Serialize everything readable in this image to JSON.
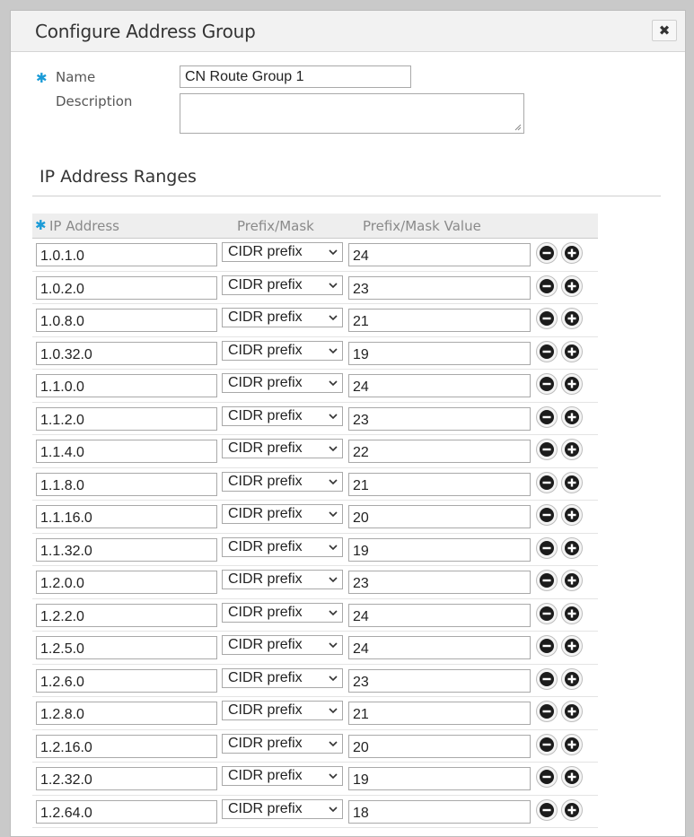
{
  "dialog": {
    "title": "Configure Address Group",
    "close_glyph": "✖"
  },
  "form": {
    "required_mark": "✱",
    "name_label": "Name",
    "name_value": "CN Route Group 1",
    "description_label": "Description",
    "description_value": ""
  },
  "ranges": {
    "section_title": "IP Address Ranges",
    "headers": {
      "required_mark": "✱",
      "ip": "IP Address",
      "prefix": "Prefix/Mask",
      "value": "Prefix/Mask Value"
    },
    "rows": [
      {
        "ip": "1.0.1.0",
        "prefix": "CIDR prefix",
        "value": "24"
      },
      {
        "ip": "1.0.2.0",
        "prefix": "CIDR prefix",
        "value": "23"
      },
      {
        "ip": "1.0.8.0",
        "prefix": "CIDR prefix",
        "value": "21"
      },
      {
        "ip": "1.0.32.0",
        "prefix": "CIDR prefix",
        "value": "19"
      },
      {
        "ip": "1.1.0.0",
        "prefix": "CIDR prefix",
        "value": "24"
      },
      {
        "ip": "1.1.2.0",
        "prefix": "CIDR prefix",
        "value": "23"
      },
      {
        "ip": "1.1.4.0",
        "prefix": "CIDR prefix",
        "value": "22"
      },
      {
        "ip": "1.1.8.0",
        "prefix": "CIDR prefix",
        "value": "21"
      },
      {
        "ip": "1.1.16.0",
        "prefix": "CIDR prefix",
        "value": "20"
      },
      {
        "ip": "1.1.32.0",
        "prefix": "CIDR prefix",
        "value": "19"
      },
      {
        "ip": "1.2.0.0",
        "prefix": "CIDR prefix",
        "value": "23"
      },
      {
        "ip": "1.2.2.0",
        "prefix": "CIDR prefix",
        "value": "24"
      },
      {
        "ip": "1.2.5.0",
        "prefix": "CIDR prefix",
        "value": "24"
      },
      {
        "ip": "1.2.6.0",
        "prefix": "CIDR prefix",
        "value": "23"
      },
      {
        "ip": "1.2.8.0",
        "prefix": "CIDR prefix",
        "value": "21"
      },
      {
        "ip": "1.2.16.0",
        "prefix": "CIDR prefix",
        "value": "20"
      },
      {
        "ip": "1.2.32.0",
        "prefix": "CIDR prefix",
        "value": "19"
      },
      {
        "ip": "1.2.64.0",
        "prefix": "CIDR prefix",
        "value": "18"
      }
    ]
  },
  "icons": {
    "close": "close-icon",
    "remove_row": "minus-circle-icon",
    "add_row": "plus-circle-icon",
    "dropdown": "chevron-down-icon"
  },
  "colors": {
    "required_accent": "#1a9bd7",
    "header_bg": "#f2f2f2",
    "backdrop": "#c9c9c9"
  }
}
